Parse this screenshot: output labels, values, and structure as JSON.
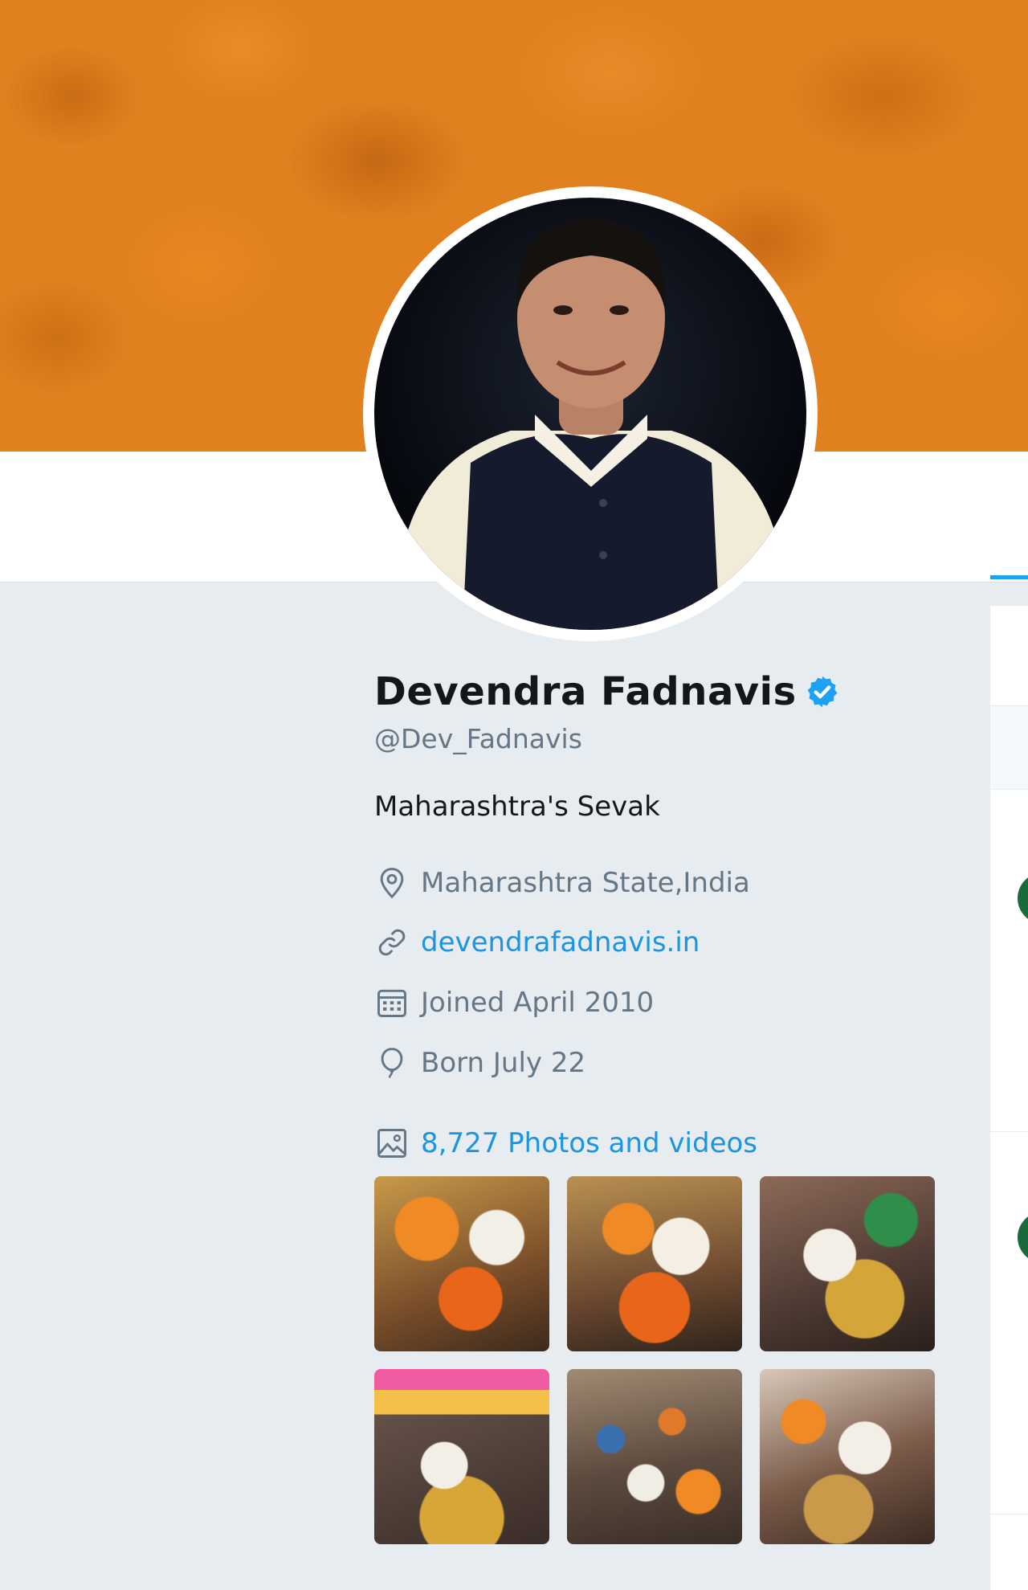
{
  "profile": {
    "name": "Devendra Fadnavis",
    "verified": true,
    "handle": "@Dev_Fadnavis",
    "bio": "Maharashtra's Sevak",
    "location": "Maharashtra State,India",
    "website": "devendrafadnavis.in",
    "joined": "Joined April 2010",
    "born": "Born July 22"
  },
  "media": {
    "photos_label": "8,727 Photos and videos",
    "thumbnails": [
      {
        "name": "media-thumb-1"
      },
      {
        "name": "media-thumb-2"
      },
      {
        "name": "media-thumb-3"
      },
      {
        "name": "media-thumb-4"
      },
      {
        "name": "media-thumb-5"
      },
      {
        "name": "media-thumb-6"
      }
    ]
  },
  "icons": {
    "location": "location-pin-icon",
    "link": "link-icon",
    "calendar": "calendar-icon",
    "birthday": "balloon-icon",
    "photos": "image-icon",
    "verified": "verified-badge-icon"
  },
  "colors": {
    "banner": "#e0801f",
    "link": "#1b95e0",
    "verified": "#1da1f2",
    "muted": "#657786",
    "page_bg": "#e6ecf0"
  }
}
